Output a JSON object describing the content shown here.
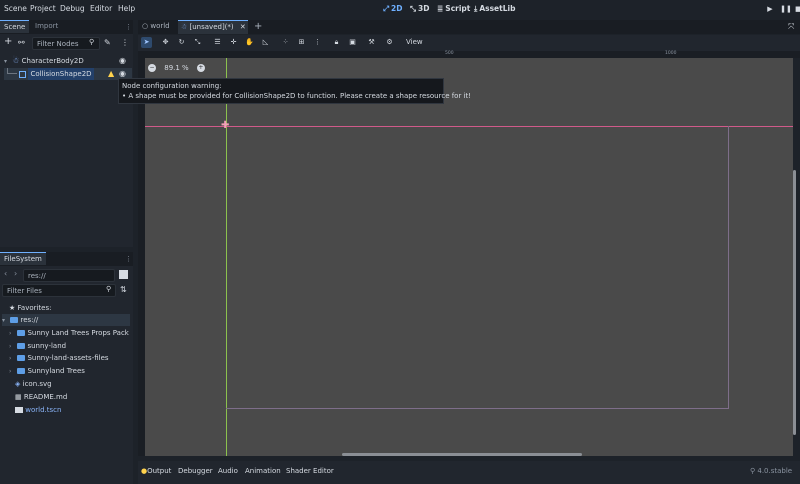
{
  "menu": [
    "Scene",
    "Project",
    "Debug",
    "Editor",
    "Help"
  ],
  "workspaces": [
    {
      "icon": "2d-icon",
      "glyph": "⤢",
      "label": "2D",
      "active": true
    },
    {
      "icon": "3d-icon",
      "glyph": "⤡",
      "label": "3D",
      "active": false
    },
    {
      "icon": "script-icon",
      "glyph": "≣",
      "label": "Script",
      "active": false
    },
    {
      "icon": "assetlib-icon",
      "glyph": "⤓",
      "label": "AssetLib",
      "active": false
    }
  ],
  "scene_dock": {
    "tabs": [
      "Scene",
      "Import"
    ],
    "filter_placeholder": "Filter Nodes",
    "nodes": [
      "CharacterBody2D",
      "CollisionShape2D"
    ]
  },
  "tooltip": {
    "title": "Node configuration warning:",
    "message": "• A shape must be provided for CollisionShape2D to function. Please create a shape resource for it!"
  },
  "filesystem": {
    "tab": "FileSystem",
    "path": "res://",
    "filter_placeholder": "Filter Files",
    "favorites_label": "Favorites:",
    "root_label": "res://",
    "folders": [
      "Sunny Land Trees Props Pack",
      "sunny-land",
      "Sunny-land-assets-files",
      "Sunnyland Trees"
    ],
    "files": [
      "icon.svg",
      "README.md",
      "world.tscn"
    ]
  },
  "scene_tabs": [
    {
      "label": "world",
      "active": false
    },
    {
      "label": "[unsaved](*)",
      "active": true
    }
  ],
  "toolbar": {
    "view_label": "View"
  },
  "ruler": {
    "mark_1": "500",
    "mark_2": "1000"
  },
  "zoom": "89.1 %",
  "bottom_panel": {
    "tabs": [
      "Output",
      "Debugger",
      "Audio",
      "Animation",
      "Shader Editor"
    ],
    "version": "4.0.stable"
  },
  "colors": {
    "accent": "#6fb0ff",
    "warning": "#ffd24d",
    "x_axis": "#d15a8a",
    "y_axis": "#8cc24e"
  }
}
